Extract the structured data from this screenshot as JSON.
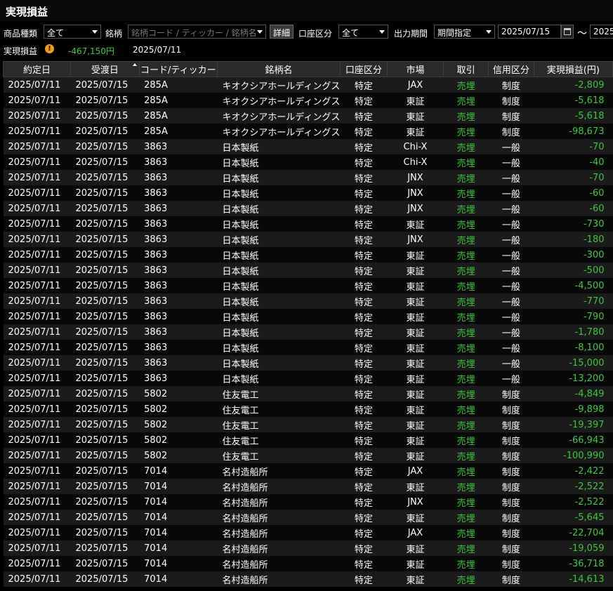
{
  "title": "実現損益",
  "filters": {
    "product_label": "商品種類",
    "product_value": "全て",
    "issue_label": "銘柄",
    "issue_placeholder": "銘柄コード / ティッカー / 銘柄名",
    "detail_button": "詳細",
    "account_label": "口座区分",
    "account_value": "全て",
    "period_label": "出力期間",
    "period_value": "期間指定",
    "date_from": "2025/07/15",
    "tilde": "～",
    "date_to": "2025"
  },
  "summary": {
    "label": "実現損益",
    "warning": "!",
    "amount": "-467,150円",
    "date": "2025/07/11"
  },
  "columns": [
    "約定日",
    "受渡日",
    "コード/ティッカー",
    "銘柄名",
    "口座区分",
    "市場",
    "取引",
    "信用区分",
    "実現損益(円)"
  ],
  "rows": [
    [
      "2025/07/11",
      "2025/07/15",
      "285A",
      "キオクシアホールディングス",
      "特定",
      "JAX",
      "売埋",
      "制度",
      "-2,809"
    ],
    [
      "2025/07/11",
      "2025/07/15",
      "285A",
      "キオクシアホールディングス",
      "特定",
      "東証",
      "売埋",
      "制度",
      "-5,618"
    ],
    [
      "2025/07/11",
      "2025/07/15",
      "285A",
      "キオクシアホールディングス",
      "特定",
      "東証",
      "売埋",
      "制度",
      "-5,618"
    ],
    [
      "2025/07/11",
      "2025/07/15",
      "285A",
      "キオクシアホールディングス",
      "特定",
      "東証",
      "売埋",
      "制度",
      "-98,673"
    ],
    [
      "2025/07/11",
      "2025/07/15",
      "3863",
      "日本製紙",
      "特定",
      "Chi-X",
      "売埋",
      "一般",
      "-70"
    ],
    [
      "2025/07/11",
      "2025/07/15",
      "3863",
      "日本製紙",
      "特定",
      "Chi-X",
      "売埋",
      "一般",
      "-40"
    ],
    [
      "2025/07/11",
      "2025/07/15",
      "3863",
      "日本製紙",
      "特定",
      "JNX",
      "売埋",
      "一般",
      "-70"
    ],
    [
      "2025/07/11",
      "2025/07/15",
      "3863",
      "日本製紙",
      "特定",
      "JNX",
      "売埋",
      "一般",
      "-60"
    ],
    [
      "2025/07/11",
      "2025/07/15",
      "3863",
      "日本製紙",
      "特定",
      "JNX",
      "売埋",
      "一般",
      "-60"
    ],
    [
      "2025/07/11",
      "2025/07/15",
      "3863",
      "日本製紙",
      "特定",
      "東証",
      "売埋",
      "一般",
      "-730"
    ],
    [
      "2025/07/11",
      "2025/07/15",
      "3863",
      "日本製紙",
      "特定",
      "JNX",
      "売埋",
      "一般",
      "-180"
    ],
    [
      "2025/07/11",
      "2025/07/15",
      "3863",
      "日本製紙",
      "特定",
      "東証",
      "売埋",
      "一般",
      "-300"
    ],
    [
      "2025/07/11",
      "2025/07/15",
      "3863",
      "日本製紙",
      "特定",
      "東証",
      "売埋",
      "一般",
      "-500"
    ],
    [
      "2025/07/11",
      "2025/07/15",
      "3863",
      "日本製紙",
      "特定",
      "東証",
      "売埋",
      "一般",
      "-4,500"
    ],
    [
      "2025/07/11",
      "2025/07/15",
      "3863",
      "日本製紙",
      "特定",
      "東証",
      "売埋",
      "一般",
      "-770"
    ],
    [
      "2025/07/11",
      "2025/07/15",
      "3863",
      "日本製紙",
      "特定",
      "東証",
      "売埋",
      "一般",
      "-790"
    ],
    [
      "2025/07/11",
      "2025/07/15",
      "3863",
      "日本製紙",
      "特定",
      "東証",
      "売埋",
      "一般",
      "-1,780"
    ],
    [
      "2025/07/11",
      "2025/07/15",
      "3863",
      "日本製紙",
      "特定",
      "東証",
      "売埋",
      "一般",
      "-8,100"
    ],
    [
      "2025/07/11",
      "2025/07/15",
      "3863",
      "日本製紙",
      "特定",
      "東証",
      "売埋",
      "一般",
      "-15,000"
    ],
    [
      "2025/07/11",
      "2025/07/15",
      "3863",
      "日本製紙",
      "特定",
      "東証",
      "売埋",
      "一般",
      "-13,200"
    ],
    [
      "2025/07/11",
      "2025/07/15",
      "5802",
      "住友電工",
      "特定",
      "東証",
      "売埋",
      "制度",
      "-4,849"
    ],
    [
      "2025/07/11",
      "2025/07/15",
      "5802",
      "住友電工",
      "特定",
      "東証",
      "売埋",
      "制度",
      "-9,898"
    ],
    [
      "2025/07/11",
      "2025/07/15",
      "5802",
      "住友電工",
      "特定",
      "東証",
      "売埋",
      "制度",
      "-19,397"
    ],
    [
      "2025/07/11",
      "2025/07/15",
      "5802",
      "住友電工",
      "特定",
      "東証",
      "売埋",
      "制度",
      "-66,943"
    ],
    [
      "2025/07/11",
      "2025/07/15",
      "5802",
      "住友電工",
      "特定",
      "東証",
      "売埋",
      "制度",
      "-100,990"
    ],
    [
      "2025/07/11",
      "2025/07/15",
      "7014",
      "名村造船所",
      "特定",
      "JAX",
      "売埋",
      "制度",
      "-2,422"
    ],
    [
      "2025/07/11",
      "2025/07/15",
      "7014",
      "名村造船所",
      "特定",
      "東証",
      "売埋",
      "制度",
      "-2,522"
    ],
    [
      "2025/07/11",
      "2025/07/15",
      "7014",
      "名村造船所",
      "特定",
      "JNX",
      "売埋",
      "制度",
      "-2,522"
    ],
    [
      "2025/07/11",
      "2025/07/15",
      "7014",
      "名村造船所",
      "特定",
      "東証",
      "売埋",
      "制度",
      "-5,645"
    ],
    [
      "2025/07/11",
      "2025/07/15",
      "7014",
      "名村造船所",
      "特定",
      "JAX",
      "売埋",
      "制度",
      "-22,704"
    ],
    [
      "2025/07/11",
      "2025/07/15",
      "7014",
      "名村造船所",
      "特定",
      "東証",
      "売埋",
      "制度",
      "-19,059"
    ],
    [
      "2025/07/11",
      "2025/07/15",
      "7014",
      "名村造船所",
      "特定",
      "東証",
      "売埋",
      "制度",
      "-36,718"
    ],
    [
      "2025/07/11",
      "2025/07/15",
      "7014",
      "名村造船所",
      "特定",
      "東証",
      "売埋",
      "制度",
      "-14,613"
    ]
  ]
}
